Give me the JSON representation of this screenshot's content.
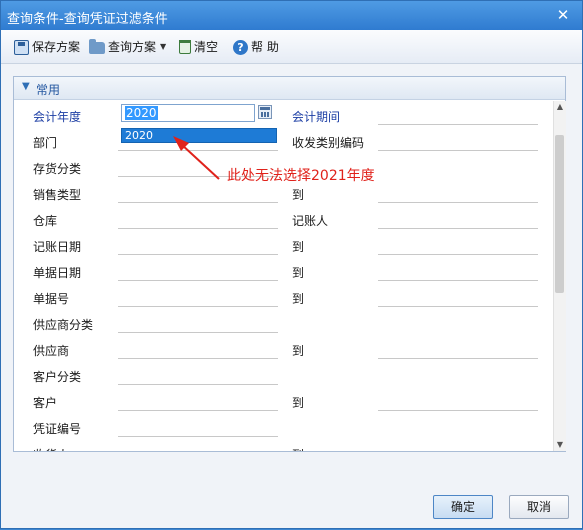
{
  "window": {
    "title": "查询条件-查询凭证过滤条件",
    "close_glyph": "✕"
  },
  "toolbar": {
    "save_plan": "保存方案",
    "query_plan": "查询方案",
    "clear": "清空",
    "help": "帮 助"
  },
  "panel": {
    "title": "常用"
  },
  "fields": [
    {
      "left": "会计年度",
      "right": "会计期间"
    },
    {
      "left": "部门",
      "right": "收发类别编码"
    },
    {
      "left": "存货分类",
      "right": ""
    },
    {
      "left": "销售类型",
      "right": "到"
    },
    {
      "left": "仓库",
      "right": "记账人"
    },
    {
      "left": "记账日期",
      "right": "到"
    },
    {
      "left": "单据日期",
      "right": "到"
    },
    {
      "left": "单据号",
      "right": "到"
    },
    {
      "left": "供应商分类",
      "right": ""
    },
    {
      "left": "供应商",
      "right": "到"
    },
    {
      "left": "客户分类",
      "right": ""
    },
    {
      "left": "客户",
      "right": "到"
    },
    {
      "left": "凭证编号",
      "right": ""
    },
    {
      "left": "收货人",
      "right": "到"
    }
  ],
  "year": {
    "value": "2020",
    "dropdown_option": "2020"
  },
  "annotation": "此处无法选择2021年度",
  "buttons": {
    "ok": "确定",
    "cancel": "取消"
  },
  "colors": {
    "title_bar": "#2f7bd0",
    "label_blue": "#1c3ea4",
    "annotation_red": "#e0221b",
    "selection": "#1e7bd6"
  }
}
